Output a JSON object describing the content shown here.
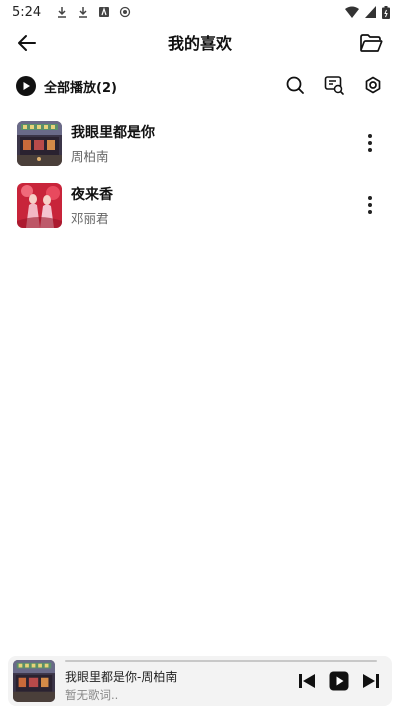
{
  "status_bar": {
    "time": "5:24",
    "left_icons": [
      "download-icon",
      "download-icon",
      "store-icon",
      "record-icon"
    ],
    "right_icons": [
      "wifi-icon",
      "signal-icon",
      "battery-icon"
    ]
  },
  "header": {
    "title": "我的喜欢",
    "back_icon": "arrow-left-icon",
    "folder_icon": "folder-open-icon"
  },
  "toolbar": {
    "play_all_label": "全部播放(2)",
    "icons": [
      "search-icon",
      "lyrics-search-icon",
      "settings-icon"
    ]
  },
  "songs": [
    {
      "title": "我眼里都是你",
      "artist": "周柏南",
      "cover": "street-night-cover"
    },
    {
      "title": "夜来香",
      "artist": "邓丽君",
      "cover": "red-dress-cover"
    }
  ],
  "player": {
    "now_playing": "我眼里都是你-周柏南",
    "lyric": "暂无歌词..",
    "progress": 0.0,
    "controls": [
      "previous-icon",
      "play-icon",
      "next-icon"
    ]
  },
  "colors": {
    "text": "#111111",
    "secondary_text": "#666666",
    "player_bg": "#f3f3f3"
  }
}
